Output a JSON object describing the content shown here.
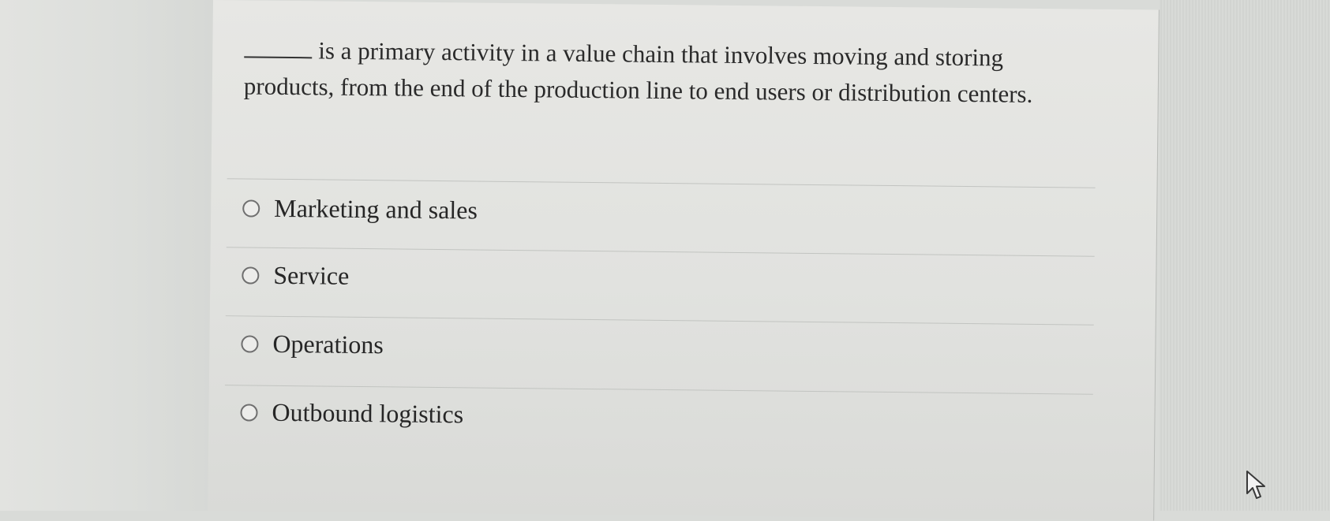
{
  "question": {
    "text": "is a primary activity in a value chain that involves moving and storing products, from the end of the production line to end users or distribution centers."
  },
  "options": [
    {
      "label": "Marketing and sales"
    },
    {
      "label": "Service"
    },
    {
      "label": "Operations"
    },
    {
      "label": "Outbound logistics"
    }
  ],
  "colors": {
    "background": "#d9dbd8",
    "page": "#e4e5e2",
    "text": "#2a2a2a",
    "radio_border": "#6f6f6f"
  },
  "icons": {
    "cursor": "mouse-pointer-icon",
    "radio": "radio-unselected-icon"
  }
}
